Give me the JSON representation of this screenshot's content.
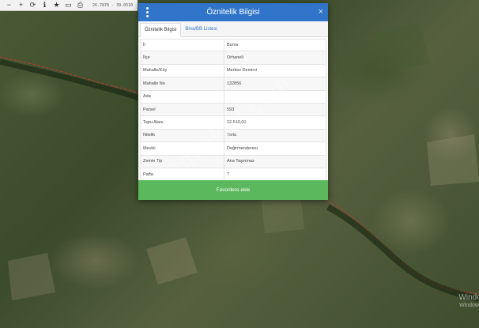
{
  "toolbar": {
    "icons": [
      "minus-icon",
      "plus-icon",
      "refresh-icon",
      "info-icon",
      "star-icon",
      "folder-icon",
      "print-icon"
    ],
    "coords": "26.7870 - 39.0510"
  },
  "dialog": {
    "title": "Öznitelik Bilgisi",
    "close_label": "×",
    "tabs": [
      {
        "label": "Öznitelik Bilgisi"
      },
      {
        "label": "Bina/BB Listesi"
      }
    ],
    "rows": [
      {
        "key": "İl",
        "value": "Bursa"
      },
      {
        "key": "İlçe",
        "value": "Orhaneli"
      },
      {
        "key": "Mahalle/Köy",
        "value": "Merkez Demirci"
      },
      {
        "key": "Mahalle No",
        "value": "132856"
      },
      {
        "key": "Ada",
        "value": ""
      },
      {
        "key": "Parsel",
        "value": "593"
      },
      {
        "key": "Tapu Alanı",
        "value": "32.640,00"
      },
      {
        "key": "Nitelik",
        "value": "Tarla"
      },
      {
        "key": "Mevkii",
        "value": "Değirmenderesi"
      },
      {
        "key": "Zemin Tip",
        "value": "Ana Taşınmaz"
      },
      {
        "key": "Pafta",
        "value": "7"
      }
    ],
    "favorite_label": "Favorilere ekle"
  },
  "watermark": "emlakjet.com",
  "os_watermark": {
    "line1": "Window",
    "line2": "Window"
  },
  "colors": {
    "header": "#2f74c8",
    "favorite": "#5cb85c",
    "parcel_line": "#c0392b"
  }
}
